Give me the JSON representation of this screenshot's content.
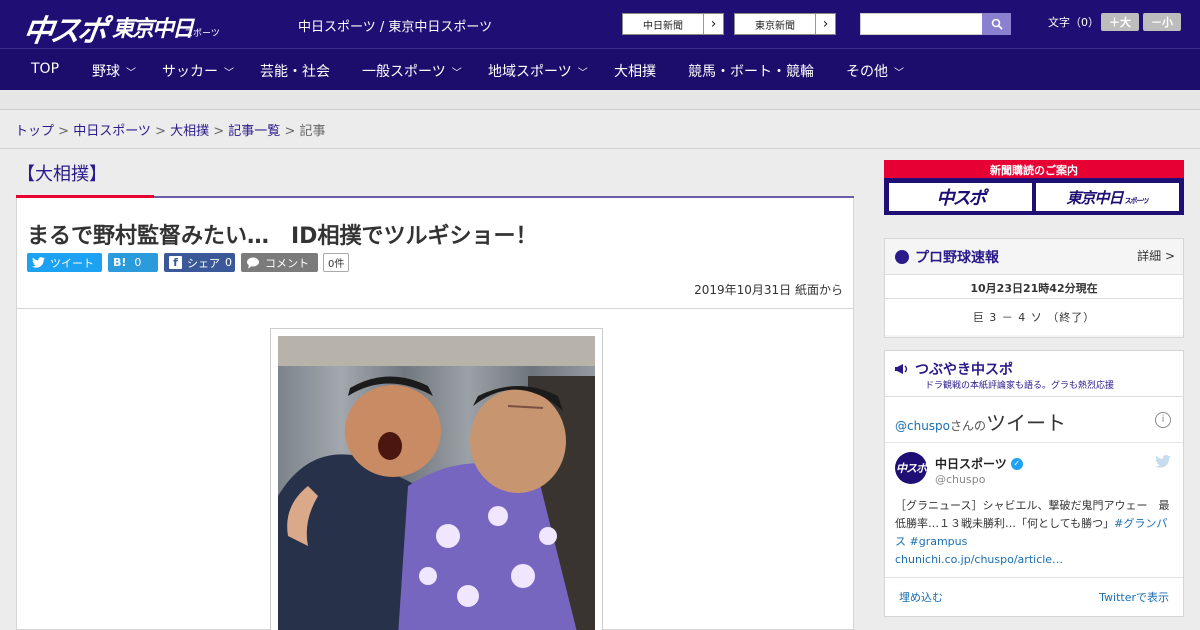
{
  "header": {
    "logo_main": "中スポ",
    "logo_tokyo": "東京中日",
    "logo_tokyo_sub": "スポーツ",
    "site_names": "中日スポーツ / 東京中日スポーツ",
    "ext_link_1": "中日新聞",
    "ext_link_2": "東京新聞",
    "font_size_label": "文字（0）",
    "font_bigger": "＋大",
    "font_smaller": "－小"
  },
  "nav": {
    "items": [
      {
        "label": "TOP"
      },
      {
        "label": "野球"
      },
      {
        "label": "サッカー"
      },
      {
        "label": "芸能・社会"
      },
      {
        "label": "一般スポーツ"
      },
      {
        "label": "地域スポーツ"
      },
      {
        "label": "大相撲"
      },
      {
        "label": "競馬・ボート・競輪"
      },
      {
        "label": "その他"
      }
    ]
  },
  "breadcrumb": {
    "items": [
      "トップ",
      "中日スポーツ",
      "大相撲",
      "記事一覧"
    ],
    "current": "記事",
    "separator": " > "
  },
  "article": {
    "category": "【大相撲】",
    "title": "まるで野村監督みたい…　ID相撲でツルギショー！",
    "share": {
      "tweet": "ツイート",
      "hatena": "B!",
      "hatena_count": "0",
      "facebook": "シェア",
      "facebook_count": "0",
      "comment": "コメント",
      "comment_count": "0件"
    },
    "date": "2019年10月31日 紙面から"
  },
  "sidebar": {
    "subscribe_title": "新聞購読のご案内",
    "subscribe_1": "中スポ",
    "subscribe_2": "東京中日",
    "subscribe_2_sub": "スポーツ",
    "baseball": {
      "title": "プロ野球速報",
      "detail": "詳細 >",
      "as_of": "10月23日21時42分現在",
      "score": "巨 3 － 4 ソ （終了）"
    },
    "tweets": {
      "title": "つぶやき中スポ",
      "subtitle": "ドラ観戦の本紙評論家も語る。グラも熱烈応援",
      "handle_prefix": "@chuspo",
      "handle_san": "さんの",
      "handle_suffix": "ツイート",
      "user_name": "中日スポーツ",
      "user_at": "@chuspo",
      "avatar_text": "中スポ",
      "tweet_text": "［グラニュース］シャビエル、撃破だ鬼門アウェー　最低勝率…１３戦未勝利…「何としても勝つ」",
      "tweet_hash1": "#グランパス",
      "tweet_hash2": "#grampus",
      "tweet_link": "chunichi.co.jp/chuspo/article…",
      "embed": "埋め込む",
      "view_on": "Twitterで表示"
    }
  },
  "colors": {
    "brand_navy": "#1f0e74",
    "accent_red": "#e60033",
    "link_blue": "#2a1a8a"
  }
}
